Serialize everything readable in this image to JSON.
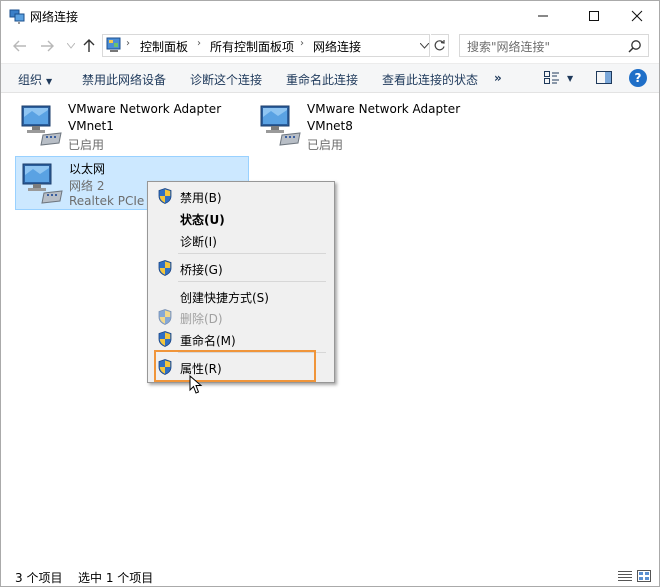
{
  "window": {
    "title": "网络连接"
  },
  "nav": {
    "back_icon": "back-arrow-icon",
    "forward_icon": "forward-arrow-icon",
    "up_icon": "up-arrow-icon",
    "breadcrumbs": [
      "控制面板",
      "所有控制面板项",
      "网络连接"
    ],
    "search_placeholder": "搜索\"网络连接\""
  },
  "toolbar": {
    "organize": "组织",
    "items": [
      "禁用此网络设备",
      "诊断这个连接",
      "重命名此连接",
      "查看此连接的状态"
    ],
    "more": "»"
  },
  "adapters": [
    {
      "name": "VMware Network Adapter",
      "line2": "VMnet1",
      "line3": "已启用",
      "selected": false
    },
    {
      "name": "VMware Network Adapter",
      "line2": "VMnet8",
      "line3": "已启用",
      "selected": false
    },
    {
      "name": "以太网",
      "line2": "网络 2",
      "line3": "Realtek PCIe G",
      "selected": true
    }
  ],
  "context_menu": {
    "items": [
      {
        "label": "禁用(B)",
        "shield": true,
        "bold": false,
        "disabled": false
      },
      {
        "label": "状态(U)",
        "shield": false,
        "bold": true,
        "disabled": false
      },
      {
        "label": "诊断(I)",
        "shield": false,
        "bold": false,
        "disabled": false
      },
      {
        "label": "桥接(G)",
        "shield": true,
        "bold": false,
        "disabled": false
      },
      {
        "label": "创建快捷方式(S)",
        "shield": false,
        "bold": false,
        "disabled": false
      },
      {
        "label": "删除(D)",
        "shield": true,
        "bold": false,
        "disabled": true
      },
      {
        "label": "重命名(M)",
        "shield": true,
        "bold": false,
        "disabled": false
      },
      {
        "label": "属性(R)",
        "shield": true,
        "bold": false,
        "disabled": false
      }
    ],
    "highlight_color": "#f0953a"
  },
  "status": {
    "count": "3 个项目",
    "selected": "选中 1 个项目"
  },
  "colors": {
    "selection_bg": "#cce8ff",
    "selection_border": "#99d1ff",
    "command_text": "#1e395b"
  }
}
